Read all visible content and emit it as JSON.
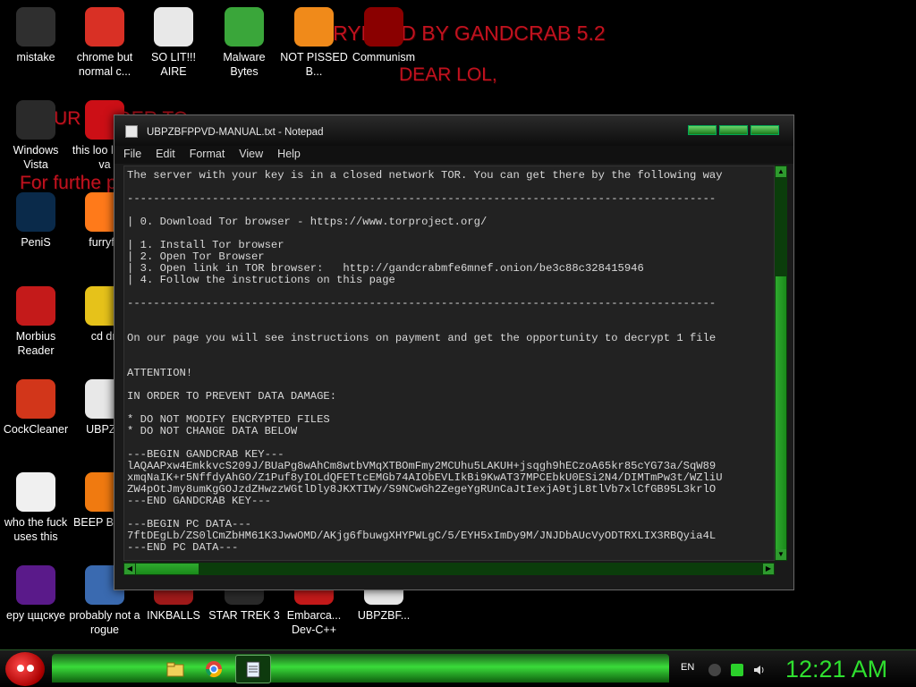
{
  "wallpaper": {
    "title": "RYPTED BY GANDCRAB 5.2",
    "dear": "DEAR LOL,",
    "order_line": "UR FIL                                      DER TO",
    "further_line": "For furthe                                                                                   pted folder"
  },
  "desktop_icons": [
    {
      "label": "mistake",
      "icon": "recycle-icon",
      "color": "#2f2f2f"
    },
    {
      "label": "chrome but normal c...",
      "icon": "chrome-icon",
      "color": "#d93025"
    },
    {
      "label": "SO LIT!!! AIRE",
      "icon": "cards-icon",
      "color": "#e8e8e8"
    },
    {
      "label": "Malware Bytes",
      "icon": "shield-icon",
      "color": "#3aa63a"
    },
    {
      "label": "NOT PISSED B...",
      "icon": "pig-icon",
      "color": "#f08a1a"
    },
    {
      "label": "Communism",
      "icon": "communism-icon",
      "color": "#8a0000"
    },
    {
      "label": "Windows Vista",
      "icon": "recycle-icon",
      "color": "#2a2a2a"
    },
    {
      "label": "this loo like a va",
      "icon": "opera-icon",
      "color": "#cc0f16"
    },
    {
      "label": "PeniS",
      "icon": "photoshop-icon",
      "color": "#0a2a4a"
    },
    {
      "label": "furryfo",
      "icon": "firefox-icon",
      "color": "#ff7a1a"
    },
    {
      "label": "Morbius Reader",
      "icon": "pdf-icon",
      "color": "#c41a1a"
    },
    {
      "label": "cd dri",
      "icon": "cd-icon",
      "color": "#e6c21a"
    },
    {
      "label": "CockCleaner",
      "icon": "ccleaner-icon",
      "color": "#d2361a"
    },
    {
      "label": "UBPZB",
      "icon": "document-icon",
      "color": "#e8e8e8"
    },
    {
      "label": "who the fuck uses this",
      "icon": "lightning-icon",
      "color": "#f0f0f0"
    },
    {
      "label": "BEEP BEEP",
      "icon": "vlc-icon",
      "color": "#f07a10"
    },
    {
      "label": "ерy цщскуе",
      "icon": "yahoo-icon",
      "color": "#5a1a8a"
    },
    {
      "label": "probably not a rogue",
      "icon": "gear-icon",
      "color": "#3a6ab0"
    },
    {
      "label": "INKBALLS",
      "icon": "inkball-icon",
      "color": "#a01a1a"
    },
    {
      "label": "STAR TREK 3",
      "icon": "starwars-icon",
      "color": "#2a2a2a"
    },
    {
      "label": "Embarca... Dev-C++",
      "icon": "cpp-icon",
      "color": "#c41a1a"
    },
    {
      "label": "UBPZBF...",
      "icon": "document-icon",
      "color": "#e8e8e8"
    }
  ],
  "notepad": {
    "title": "UBPZBFPPVD-MANUAL.txt - Notepad",
    "menu": [
      "File",
      "Edit",
      "Format",
      "View",
      "Help"
    ],
    "content": "The server with your key is in a closed network TOR. You can get there by the following way\n\n------------------------------------------------------------------------------------------\n\n| 0. Download Tor browser - https://www.torproject.org/\n\n| 1. Install Tor browser\n| 2. Open Tor Browser\n| 3. Open link in TOR browser:   http://gandcrabmfe6mnef.onion/be3c88c328415946\n| 4. Follow the instructions on this page\n\n------------------------------------------------------------------------------------------\n\n\nOn our page you will see instructions on payment and get the opportunity to decrypt 1 file\n\n\nATTENTION!\n\nIN ORDER TO PREVENT DATA DAMAGE:\n\n* DO NOT MODIFY ENCRYPTED FILES\n* DO NOT CHANGE DATA BELOW\n\n---BEGIN GANDCRAB KEY---\nlAQAAPxw4EmkkvcS209J/BUaPg8wAhCm8wtbVMqXTBOmFmy2MCUhu5LAKUH+jsqgh9hECzoA65kr85cYG73a/SqW89\nxmqNaIK+r5NffdyAhGO/Z1Puf8yIOLdQFETtcEMGb74AIObEVLIkBi9KwAT37MPCEbkU0ESi2N4/DIMTmPw3t/WZliU\nZW4pOtJmy8umKgGOJzdZHwzzWGtlDly8JKXTIWy/S9NCwGh2ZegeYgRUnCaJtIexjA9tjL8tlVb7xlCfGB95L3krlO\n---END GANDCRAB KEY---\n\n---BEGIN PC DATA---\n7ftDEgLb/ZS0lCmZbHM61K3JwwOMD/AKjg6fbuwgXHYPWLgC/5/EYH5xImDy9M/JNJDbAUcVyODTRXLIX3RBQyia4L\n---END PC DATA---"
  },
  "taskbar": {
    "language": "EN",
    "clock": "12:21 AM",
    "pinned": [
      "folder-icon",
      "chrome-icon",
      "notepad-icon"
    ]
  }
}
